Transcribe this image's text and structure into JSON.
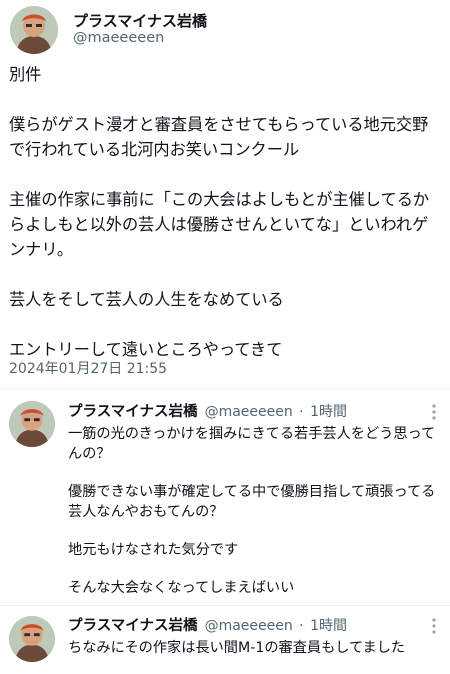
{
  "main_tweet": {
    "display_name": "プラスマイナス岩橋",
    "handle": "@maeeeeen",
    "paragraphs": [
      "別件",
      "僕らがゲスト漫才と審査員をさせてもらっている地元交野で行われている北河内お笑いコンクール",
      "主催の作家に事前に「この大会はよしもとが主催してるからよしもと以外の芸人は優勝させんといてな」といわれゲンナリ。",
      "芸人をそして芸人の人生をなめている",
      "エントリーして遠いところやってきて"
    ],
    "timestamp": "2024年01月27日 21:55"
  },
  "replies": [
    {
      "display_name": "プラスマイナス岩橋",
      "handle": "@maeeeeen",
      "time": "1時間",
      "paragraphs": [
        "一筋の光のきっかけを掴みにきてる若手芸人をどう思ってんの？",
        "優勝できない事が確定してる中で優勝目指して頑張ってる芸人なんやおもてんの？",
        "地元もけなされた気分です",
        "そんな大会なくなってしまえばいい"
      ]
    },
    {
      "display_name": "プラスマイナス岩橋",
      "handle": "@maeeeeen",
      "time": "1時間",
      "paragraphs": [
        "ちなみにその作家は長い間M-1の審査員もしてました"
      ]
    }
  ],
  "colors": {
    "text": "#0f1419",
    "secondary": "#536471",
    "divider": "#eff3f4"
  },
  "icons": {
    "more": "more-vertical-icon",
    "avatar": "avatar"
  }
}
